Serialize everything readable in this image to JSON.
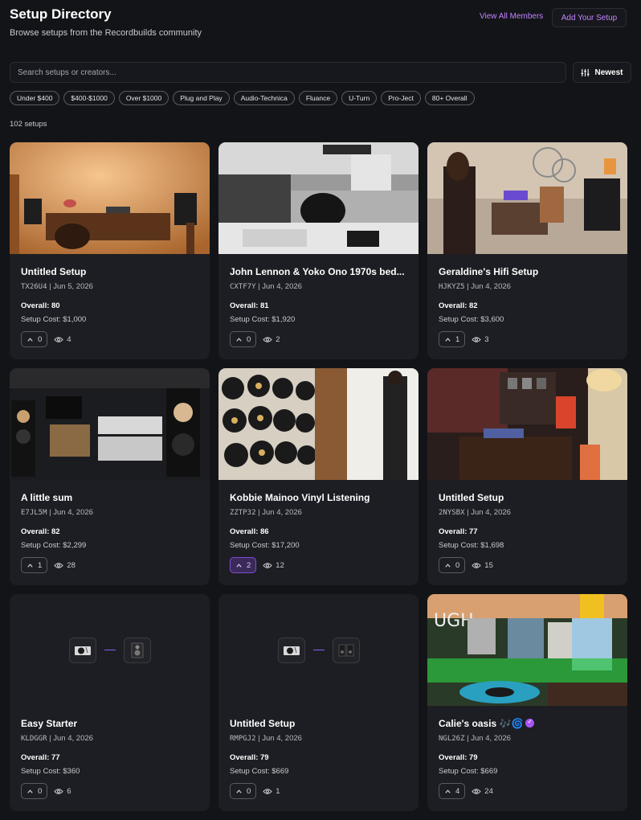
{
  "header": {
    "title": "Setup Directory",
    "subtitle": "Browse setups from the Recordbuilds community",
    "view_all_label": "View All Members",
    "add_label": "Add Your Setup"
  },
  "search": {
    "placeholder": "Search setups or creators...",
    "value": ""
  },
  "sort": {
    "label": "Newest",
    "icon": "sliders-icon"
  },
  "filters": [
    "Under $400",
    "$400-$1000",
    "Over $1000",
    "Plug and Play",
    "Audio-Technica",
    "Fluance",
    "U-Turn",
    "Pro-Ject",
    "80+ Overall"
  ],
  "count_label": "102 setups",
  "colors": {
    "accent": "#c084fc",
    "background": "#131418",
    "card": "#1d1e23"
  },
  "cards": [
    {
      "title": "Untitled Setup",
      "code": "TX26U4",
      "date": "Jun 5, 2026",
      "overall": "Overall: 80",
      "cost": "Setup Cost: $1,000",
      "votes": "0",
      "views": "4",
      "image": "warm-room-photo"
    },
    {
      "title": "John Lennon & Yoko Ono 1970s bed...",
      "code": "CXTF7Y",
      "date": "Jun 4, 2026",
      "overall": "Overall: 81",
      "cost": "Setup Cost: $1,920",
      "votes": "0",
      "views": "2",
      "image": "black-white-photo"
    },
    {
      "title": "Geraldine's Hifi Setup",
      "code": "HJKYZ5",
      "date": "Jun 4, 2026",
      "overall": "Overall: 82",
      "cost": "Setup Cost: $3,600",
      "votes": "1",
      "views": "3",
      "image": "colorful-room-photo"
    },
    {
      "title": "A little sum",
      "code": "E7JL5M",
      "date": "Jun 4, 2026",
      "overall": "Overall: 82",
      "cost": "Setup Cost: $2,299",
      "votes": "1",
      "views": "28",
      "image": "hifi-rack-photo"
    },
    {
      "title": "Kobbie Mainoo Vinyl Listening",
      "code": "ZZTP32",
      "date": "Jun 4, 2026",
      "overall": "Overall: 86",
      "cost": "Setup Cost: $17,200",
      "votes": "2",
      "views": "12",
      "image": "vinyl-wall-photo",
      "voted": true
    },
    {
      "title": "Untitled Setup",
      "code": "2NYSBX",
      "date": "Jun 4, 2026",
      "overall": "Overall: 77",
      "cost": "Setup Cost: $1,698",
      "votes": "0",
      "views": "15",
      "image": "dark-room-photo"
    },
    {
      "title": "Easy Starter",
      "code": "KLDGGR",
      "date": "Jun 4, 2026",
      "overall": "Overall: 77",
      "cost": "Setup Cost: $360",
      "votes": "0",
      "views": "6",
      "image": "placeholder-devices"
    },
    {
      "title": "Untitled Setup",
      "code": "RMPGJ2",
      "date": "Jun 4, 2026",
      "overall": "Overall: 79",
      "cost": "Setup Cost: $669",
      "votes": "0",
      "views": "1",
      "image": "placeholder-devices"
    },
    {
      "title": "Calie's oasis 🎶🌀",
      "code": "NGL26Z",
      "date": "Jun 4, 2026",
      "overall": "Overall: 79",
      "cost": "Setup Cost: $669",
      "votes": "4",
      "views": "24",
      "image": "green-neon-photo",
      "verified": true
    }
  ]
}
